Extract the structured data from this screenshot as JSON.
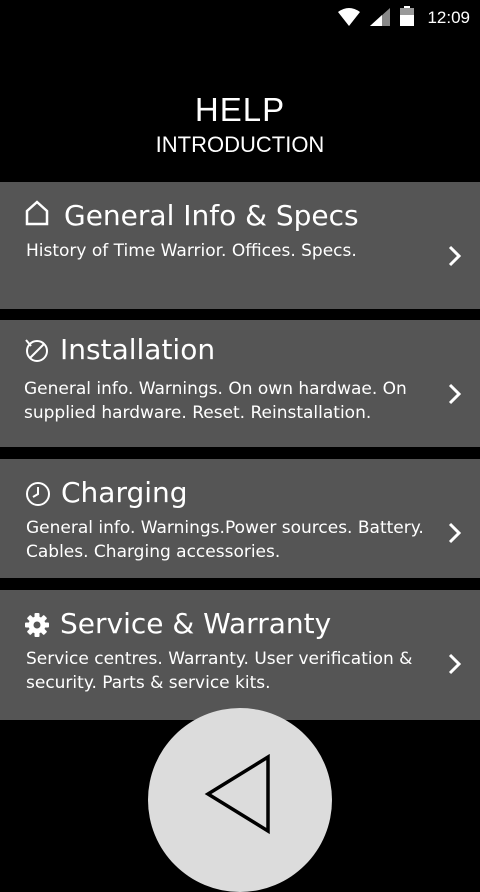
{
  "status_bar": {
    "time": "12:09",
    "icons": [
      "wifi-icon",
      "signal-icon",
      "battery-icon"
    ]
  },
  "header": {
    "title": "HELP",
    "subtitle": "INTRODUCTION"
  },
  "menu": [
    {
      "icon": "home-icon",
      "title": "General Info & Specs",
      "description": "History of Time Warrior. Offices. Specs."
    },
    {
      "icon": "installation-icon",
      "title": "Installation",
      "description": "General info. Warnings. On own hardwae. On supplied hardware. Reset. Reinstallation."
    },
    {
      "icon": "clock-icon",
      "title": "Charging",
      "description": "General info. Warnings.Power sources. Battery. Cables. Charging accessories."
    },
    {
      "icon": "gear-icon",
      "title": "Service & Warranty",
      "description": "Service centres. Warranty. User verification & security.  Parts & service kits."
    }
  ],
  "colors": {
    "background": "#000000",
    "card": "#555555",
    "text": "#ffffff",
    "back_button": "#dcdcdc"
  }
}
